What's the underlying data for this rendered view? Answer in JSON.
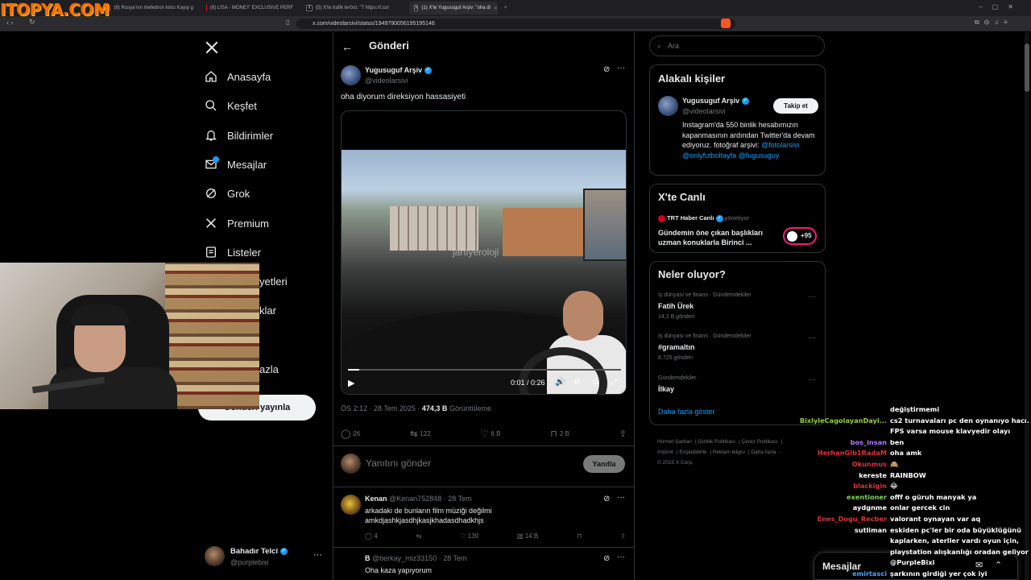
{
  "overlay_logo": "ITOPYA.COM",
  "browser": {
    "tabs": [
      {
        "title": "(8) Rusya'nın mefedron kılıcı Kayıp g"
      },
      {
        "title": "(8) LISA - MONEY' EXCLUSIVE PERF"
      },
      {
        "title": "(5) X'te trafik terörü: \"7 https://t.co/"
      },
      {
        "title": "(1) X'te Yugusuguf Arşiv: \"oha di"
      }
    ],
    "url": "x.com/videolarsivi/status/1949790056195195146"
  },
  "nav": {
    "items": [
      {
        "label": "Anasayfa"
      },
      {
        "label": "Keşfet"
      },
      {
        "label": "Bildirimler"
      },
      {
        "label": "Mesajlar"
      },
      {
        "label": "Grok"
      },
      {
        "label": "Premium"
      },
      {
        "label": "Listeler"
      },
      {
        "label": "yetleri"
      },
      {
        "label": "klar"
      },
      {
        "label": "azla"
      }
    ],
    "post_button": "Gönderi yayınla",
    "account": {
      "name": "Bahadır Telci",
      "handle": "@purplebixi"
    }
  },
  "post": {
    "header_title": "Gönderi",
    "author_name": "Yugusuguf Arşiv",
    "author_handle": "@videolarsivi",
    "text": "oha diyorum direksiyon hassasiyeti",
    "video": {
      "watermark": "jartiyeroloji",
      "time": "0:01 / 0:26",
      "progress": 0.04
    },
    "meta_time": "ÖS 2:12 · 28 Tem 2025 · ",
    "meta_views": "474,3 B",
    "meta_views_label": " Görüntüleme",
    "stats": {
      "replies": "26",
      "reposts": "122",
      "likes": "6 B",
      "bookmarks": "2 B"
    },
    "reply_placeholder": "Yanıtını gönder",
    "reply_button": "Yanıtla"
  },
  "replies": [
    {
      "name": "Kenan",
      "handle": "@Kenan752848 · 28 Tem",
      "text": "arkadaki de bunların film müziği değilmi amkdjashkjasdhjkasjkhadasdhadkhjs",
      "replies": "4",
      "likes": "139",
      "views": "14 B"
    },
    {
      "name": "B",
      "handle": "@berkay_miz33150 · 28 Tem",
      "text": "Oha kaza yapıyorum"
    }
  ],
  "sidebar": {
    "search_placeholder": "Ara",
    "related_title": "Alakalı kişiler",
    "related": {
      "name": "Yugusuguf Arşiv",
      "handle": "@videolarsivi",
      "follow": "Takip et",
      "bio": "Instagram'da 550 binlik hesabımızın kapanmasının ardından Twitter'da devam ediyoruz. fotoğraf arşivi:",
      "bio_links": "@fotolarsivi @onlyfutboltayfa @fugusuguy"
    },
    "live_title": "X'te Canlı",
    "live": {
      "host": "TRT Haber Canlı",
      "role": "yönetiyor",
      "text": "Gündemin öne çıkan başlıkları uzman konuklarla Birinci ...",
      "count": "+95"
    },
    "trends_title": "Neler oluyor?",
    "trends": [
      {
        "context": "İş dünyası ve finans · Gündemdekiler",
        "title": "Fatih Ürek",
        "count": "14,2 B gönderi"
      },
      {
        "context": "İş dünyası ve finans · Gündemdekiler",
        "title": "#gramaltın",
        "count": "8.725 gönderi"
      },
      {
        "context": "Gündemdekiler",
        "title": "İlkay",
        "count": ""
      }
    ],
    "show_more": "Daha fazla göster",
    "footer": [
      "Hizmet Şartları",
      "Gizlilik Politikası",
      "Çerez Politikası",
      "Imprint",
      "Erişilebilirlik",
      "Reklam bilgisi",
      "Daha fazla ···",
      "© 2025 X Corp."
    ]
  },
  "chat": [
    {
      "user": "",
      "msg": "değiştirmemi",
      "color": "#ffffff"
    },
    {
      "user": "BixlyleCagolayanDayi...",
      "msg": "cs2 turnavaları pc den oynanıyo hacı.",
      "color": "#9acd32"
    },
    {
      "user": "",
      "msg": "FPS varsa mouse klavyedir olayı",
      "color": "#ffffff"
    },
    {
      "user": "bos_insan",
      "msg": "ben",
      "color": "#b07cff"
    },
    {
      "user": "HerhanGib1RadaM",
      "msg": "oha amk",
      "color": "#e0313a"
    },
    {
      "user": "Okunmus",
      "msg": "🙈",
      "color": "#e0313a"
    },
    {
      "user": "kereste",
      "msg": "RAINBOW",
      "color": "#ffffff"
    },
    {
      "user": "blackigin",
      "msg": "😂",
      "color": "#e0313a"
    },
    {
      "user": "exentioner",
      "msg": "offf o güruh manyak ya",
      "color": "#7fd45a"
    },
    {
      "user": "aydgnme",
      "msg": "onlar gercek cin",
      "color": "#ffffff"
    },
    {
      "user": "Enes_Dogu_Recber",
      "msg": "valorant oynayan var aq",
      "color": "#e0313a"
    },
    {
      "user": "sutliman",
      "msg": "eskiden pc'ler bir oda büyüklüğünü kaplarken, aterller vardı oyun için, playstation alışkanlığı oradan geliyor",
      "color": "#ffffff"
    },
    {
      "user": "",
      "msg": "@PurpleBixi",
      "color": "#ffffff"
    },
    {
      "user": "emirtasci",
      "msg": "şarkının girdiği yer çok iyi",
      "color": "#4aa3ff"
    }
  ],
  "messages_bar": {
    "label": "Mesajlar"
  }
}
